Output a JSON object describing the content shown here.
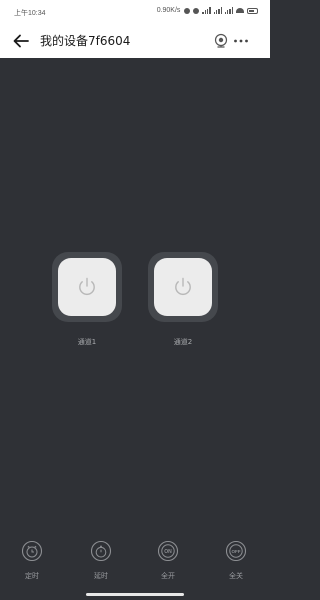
{
  "status_bar": {
    "time": "上午10:34",
    "net_speed": "0.90K/s"
  },
  "header": {
    "title": "我的设备7f6604",
    "back_icon": "arrow-left-icon",
    "camera_icon": "camera-icon",
    "more_icon": "more-dots-icon"
  },
  "channels": [
    {
      "label": "通道1",
      "icon": "power-icon"
    },
    {
      "label": "通道2",
      "icon": "power-icon"
    }
  ],
  "bottom_actions": [
    {
      "label": "定时",
      "icon": "alarm-clock-icon"
    },
    {
      "label": "延时",
      "icon": "stopwatch-icon"
    },
    {
      "label": "全开",
      "icon": "all-on-icon",
      "badge": "ON"
    },
    {
      "label": "全关",
      "icon": "all-off-icon",
      "badge": "OFF"
    }
  ],
  "colors": {
    "background": "#2f3136",
    "header": "#ffffff",
    "button_face": "#ececec",
    "button_ring": "#45484d"
  }
}
